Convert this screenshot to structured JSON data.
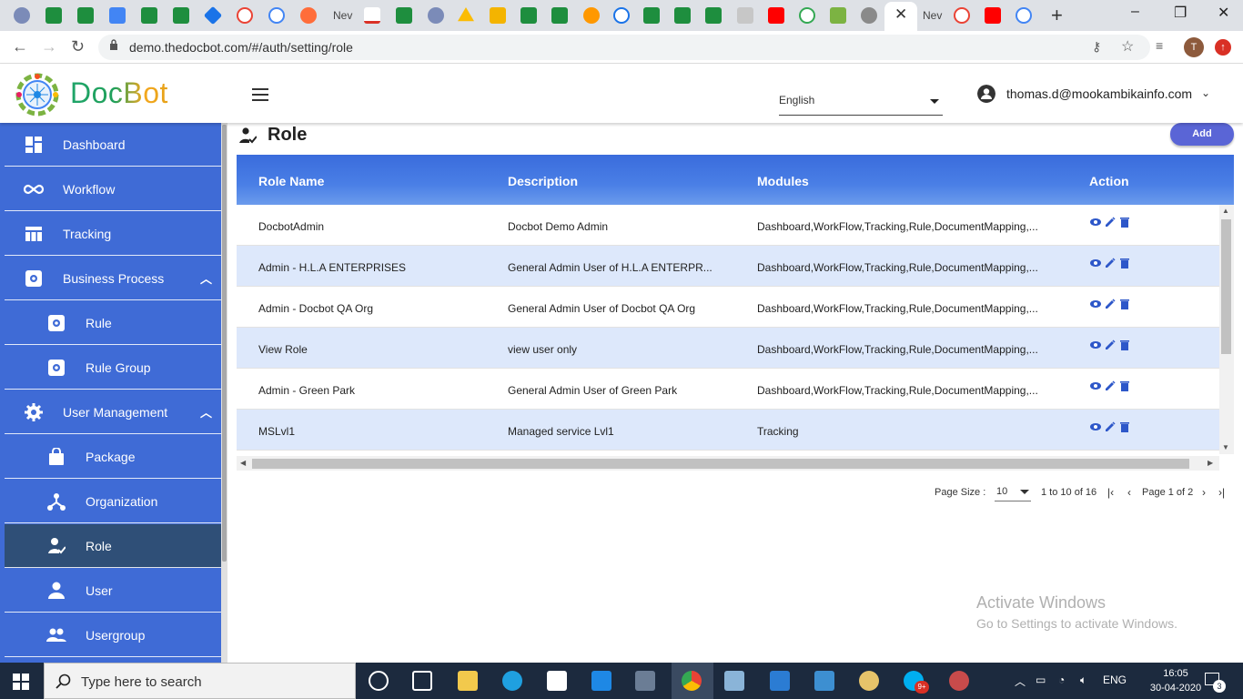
{
  "browser": {
    "url": "demo.thedocbot.com/#/auth/setting/role",
    "profile_initial": "T",
    "tab_labels": [
      "Nev",
      "Nev"
    ]
  },
  "header": {
    "brand": "DocBot",
    "language": "English",
    "user_email": "thomas.d@mookambikainfo.com"
  },
  "sidebar": {
    "items": [
      {
        "label": "Dashboard",
        "icon": "dashboard-icon"
      },
      {
        "label": "Workflow",
        "icon": "infinity-icon"
      },
      {
        "label": "Tracking",
        "icon": "table-icon"
      },
      {
        "label": "Business Process",
        "icon": "gear-icon"
      },
      {
        "label": "Rule",
        "icon": "gear-icon"
      },
      {
        "label": "Rule Group",
        "icon": "gear-icon"
      },
      {
        "label": "User Management",
        "icon": "settings-icon"
      },
      {
        "label": "Package",
        "icon": "bag-icon"
      },
      {
        "label": "Organization",
        "icon": "network-icon"
      },
      {
        "label": "Role",
        "icon": "user-check-icon"
      },
      {
        "label": "User",
        "icon": "person-icon"
      },
      {
        "label": "Usergroup",
        "icon": "people-icon"
      }
    ],
    "active": "Role"
  },
  "page": {
    "title": "Role",
    "add_label": "Add"
  },
  "table": {
    "columns": [
      "Role Name",
      "Description",
      "Modules",
      "Action"
    ],
    "rows": [
      {
        "name": "DocbotAdmin",
        "description": "Docbot Demo Admin",
        "modules": "Dashboard,WorkFlow,Tracking,Rule,DocumentMapping,..."
      },
      {
        "name": "Admin - H.L.A ENTERPRISES",
        "description": "General Admin User of H.L.A ENTERPR...",
        "modules": "Dashboard,WorkFlow,Tracking,Rule,DocumentMapping,..."
      },
      {
        "name": "Admin - Docbot QA Org",
        "description": "General Admin User of Docbot QA Org",
        "modules": "Dashboard,WorkFlow,Tracking,Rule,DocumentMapping,..."
      },
      {
        "name": "View Role",
        "description": "view user only",
        "modules": "Dashboard,WorkFlow,Tracking,Rule,DocumentMapping,..."
      },
      {
        "name": "Admin - Green Park",
        "description": "General Admin User of Green Park",
        "modules": "Dashboard,WorkFlow,Tracking,Rule,DocumentMapping,..."
      },
      {
        "name": "MSLvl1",
        "description": "Managed service Lvl1",
        "modules": "Tracking"
      }
    ]
  },
  "pager": {
    "page_size_label": "Page Size :",
    "page_size": "10",
    "range": "1 to 10 of 16",
    "page": "Page 1 of 2"
  },
  "watermark": {
    "line1": "Activate Windows",
    "line2": "Go to Settings to activate Windows."
  },
  "taskbar": {
    "search_placeholder": "Type here to search",
    "language": "ENG",
    "time": "16:05",
    "date": "30-04-2020",
    "notification_count": "3",
    "skype_badge": "9+"
  },
  "colors": {
    "sidebar": "#3f6bd6",
    "sidebar_active": "#2f4f77",
    "header_blue": "#4a7fe6",
    "row_alt": "#dde8fb",
    "add_button": "#5a65d6",
    "action_icon": "#2d57c9"
  }
}
